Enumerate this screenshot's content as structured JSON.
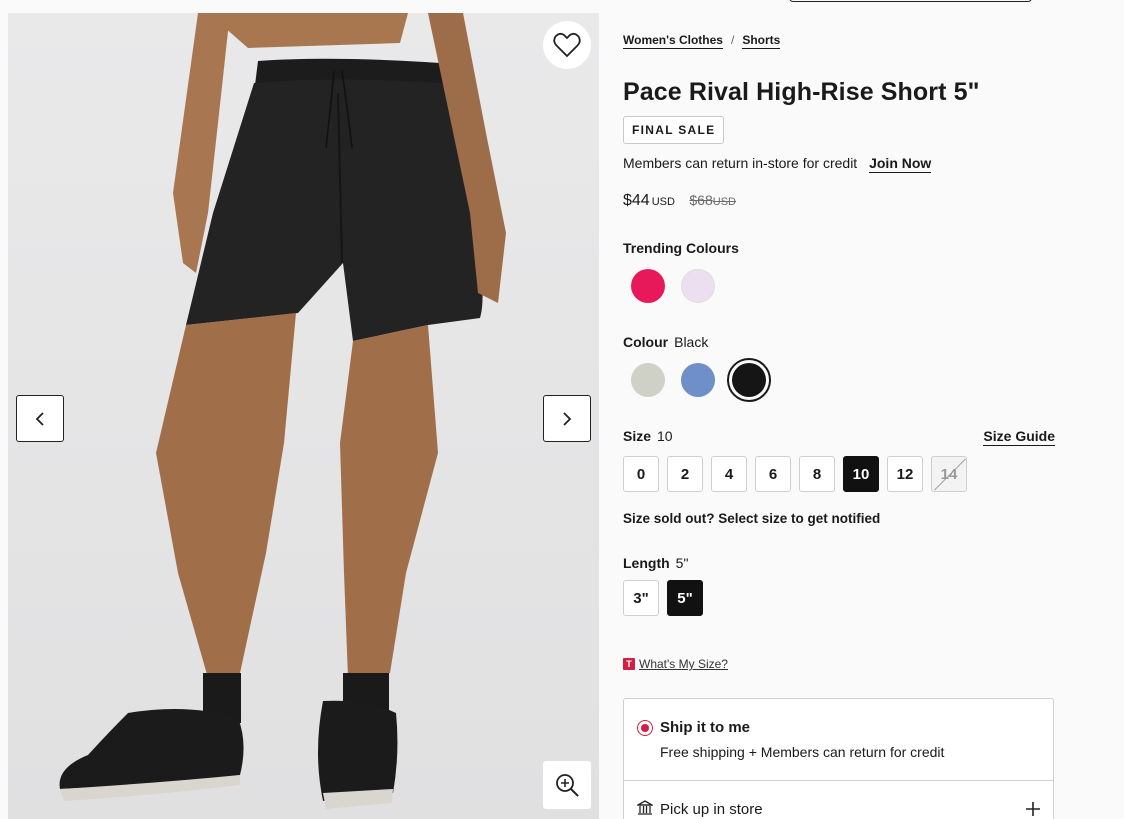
{
  "breadcrumb": [
    {
      "label": "Women's Clothes"
    },
    {
      "label": "Shorts"
    }
  ],
  "breadcrumb_sep": "/",
  "product": {
    "title": "Pace Rival High-Rise Short 5\"",
    "badge": "FINAL SALE",
    "members_text": "Members can return in-store for credit",
    "join_label": "Join Now",
    "price_now": "$44",
    "price_now_currency": "USD",
    "price_was": "$68",
    "price_was_currency": "USD"
  },
  "trending": {
    "label": "Trending Colours",
    "swatches": [
      {
        "name": "pink",
        "color": "#e8195a"
      },
      {
        "name": "lavender",
        "color": "#ece0f0"
      }
    ]
  },
  "colour": {
    "label": "Colour",
    "selected": "Black",
    "swatches": [
      {
        "name": "sage",
        "color": "#cfd0c6"
      },
      {
        "name": "blue",
        "color": "#6f8fc8"
      },
      {
        "name": "black",
        "color": "#151515",
        "selected": true
      }
    ]
  },
  "size": {
    "label": "Size",
    "selected": "10",
    "guide_label": "Size Guide",
    "options": [
      "0",
      "2",
      "4",
      "6",
      "8",
      "10",
      "12",
      "14"
    ],
    "sold_out": [
      "14"
    ],
    "note": "Size sold out? Select size to get notified"
  },
  "length": {
    "label": "Length",
    "selected": "5\"",
    "options": [
      "3\"",
      "5\""
    ]
  },
  "wms": {
    "badge": "T",
    "link": "What's My Size?"
  },
  "shipping": {
    "ship_title": "Ship it to me",
    "ship_sub": "Free shipping + Members can return for credit",
    "pickup_title": "Pick up in store"
  },
  "icons": {
    "favorite": "heart-icon",
    "prev": "chevron-left-icon",
    "next": "chevron-right-icon",
    "zoom": "zoom-in-icon",
    "store": "store-icon",
    "expand": "plus-icon"
  }
}
